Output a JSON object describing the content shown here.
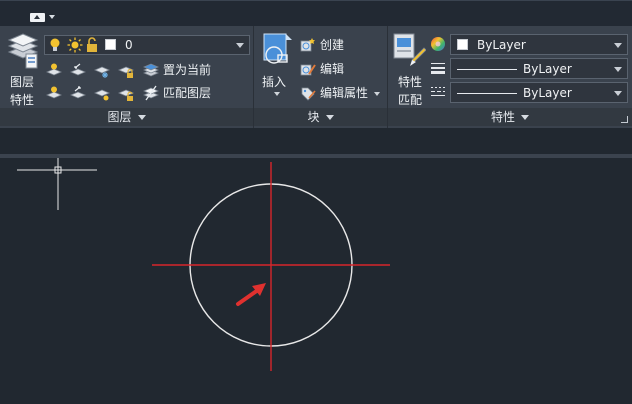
{
  "quick_access": {
    "menu_icon": "caret-down-icon"
  },
  "layers_panel": {
    "title": "图层",
    "layer_properties_label_1": "图层",
    "layer_properties_label_2": "特性",
    "current_layer": "0",
    "make_current_label": "置为当前",
    "match_layer_label": "匹配图层"
  },
  "block_panel": {
    "title": "块",
    "insert_label": "插入",
    "create_label": "创建",
    "edit_label": "编辑",
    "edit_attributes_label": "编辑属性"
  },
  "properties_panel": {
    "title": "特性",
    "match_properties_label_1": "特性",
    "match_properties_label_2": "匹配",
    "color_value": "ByLayer",
    "lineweight_value": "ByLayer",
    "linetype_value": "ByLayer"
  },
  "colors": {
    "ribbon_bg": "#3a424d",
    "canvas_bg": "#212830",
    "circle_stroke": "#e8e8e8",
    "crosshair_red": "#d7262b",
    "arrow_red": "#e0312f",
    "lightbulb": "#f2c230",
    "sun": "#f2c230",
    "lock": "#e2b53a"
  }
}
